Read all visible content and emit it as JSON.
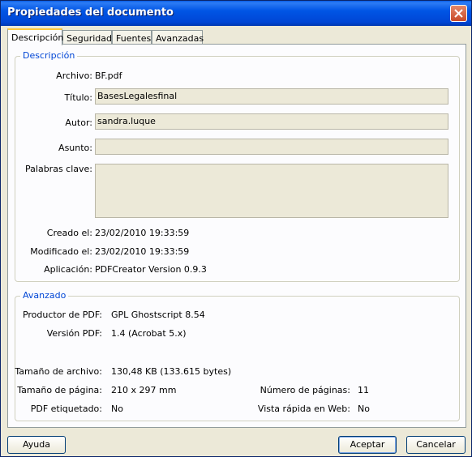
{
  "window": {
    "title": "Propiedades del documento"
  },
  "tabs": [
    {
      "label": "Descripción"
    },
    {
      "label": "Seguridad"
    },
    {
      "label": "Fuentes"
    },
    {
      "label": "Avanzadas"
    }
  ],
  "descripcion": {
    "legend": "Descripción",
    "archivo_label": "Archivo:",
    "archivo_value": "BF.pdf",
    "titulo_label": "Título:",
    "titulo_value": "BasesLegalesfinal",
    "autor_label": "Autor:",
    "autor_value": "sandra.luque",
    "asunto_label": "Asunto:",
    "asunto_value": "",
    "palabras_label": "Palabras clave:",
    "palabras_value": "",
    "creado_label": "Creado el:",
    "creado_value": "23/02/2010 19:33:59",
    "modificado_label": "Modificado el:",
    "modificado_value": "23/02/2010 19:33:59",
    "aplicacion_label": "Aplicación:",
    "aplicacion_value": "PDFCreator Version 0.9.3"
  },
  "avanzado": {
    "legend": "Avanzado",
    "productor_label": "Productor de PDF:",
    "productor_value": "GPL Ghostscript 8.54",
    "version_label": "Versión PDF:",
    "version_value": "1.4 (Acrobat 5.x)",
    "tam_archivo_label": "Tamaño de archivo:",
    "tam_archivo_value": "130,48 KB (133.615 bytes)",
    "tam_pagina_label": "Tamaño de página:",
    "tam_pagina_value": "210 x 297 mm",
    "num_paginas_label": "Número de páginas:",
    "num_paginas_value": "11",
    "etiquetado_label": "PDF etiquetado:",
    "etiquetado_value": "No",
    "vista_rapida_label": "Vista rápida en Web:",
    "vista_rapida_value": "No"
  },
  "buttons": {
    "ayuda": "Ayuda",
    "aceptar": "Aceptar",
    "cancelar": "Cancelar"
  }
}
